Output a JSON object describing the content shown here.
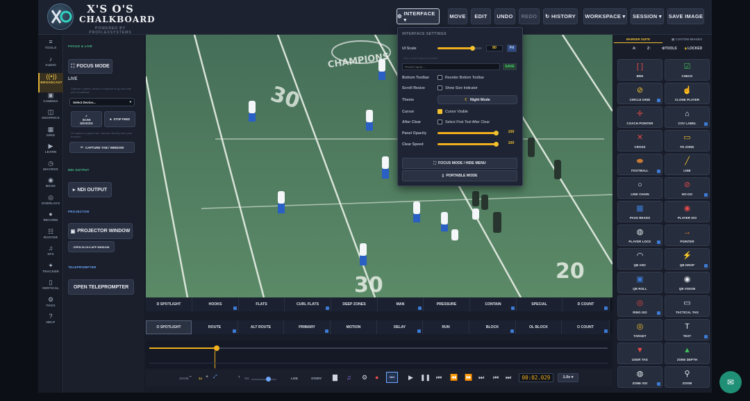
{
  "brand": {
    "line1": "X'S O'S",
    "line2": "CHALKBOARD",
    "tagline": "POWERED BY PROFLEXSYSTEMS"
  },
  "toolbar": {
    "interface": "INTERFACE ▾",
    "move": "MOVE",
    "edit": "EDIT",
    "undo": "UNDO",
    "redo": "REDO",
    "history": "HISTORY",
    "workspace": "WORKSPACE ▾",
    "session": "SESSION ▾",
    "save_image": "SAVE IMAGE"
  },
  "nav": [
    {
      "label": "TOOLS",
      "icon": "≡"
    },
    {
      "label": "AUDIO",
      "icon": "♪"
    },
    {
      "label": "BROADCAST",
      "icon": "((•))"
    },
    {
      "label": "CAMERA",
      "icon": "▣"
    },
    {
      "label": "GRAPHICS",
      "icon": "◫"
    },
    {
      "label": "GRID",
      "icon": "▦"
    },
    {
      "label": "LEARN",
      "icon": "▶"
    },
    {
      "label": "MACROS",
      "icon": "◷"
    },
    {
      "label": "MASK",
      "icon": "◉"
    },
    {
      "label": "OVERLAYS",
      "icon": "◎"
    },
    {
      "label": "RECORD",
      "icon": "●"
    },
    {
      "label": "ROSTER",
      "icon": "☷"
    },
    {
      "label": "SFX",
      "icon": "♫"
    },
    {
      "label": "TRACKER",
      "icon": "✦"
    },
    {
      "label": "VERTICAL",
      "icon": "▯"
    },
    {
      "label": "TAGS",
      "icon": "⚙"
    },
    {
      "label": "HELP",
      "icon": "?"
    }
  ],
  "left_panel": {
    "focus_live": "FOCUS & LIVE",
    "focus_mode": "FOCUS MODE",
    "live": "LIVE",
    "live_help": "Capture a game, device or window to go live with your broadcast.",
    "select_device": "Select Device...",
    "scan_devices": "SCAN DEVICES",
    "stop_feed": "STOP FEED",
    "capture_help": "Or capture a game tab / window directly from your browser.",
    "capture_tab": "CAPTURE TAB / WINDOW",
    "ndi_output_sec": "NDI OUTPUT",
    "ndi_output": "NDI OUTPUT",
    "projector_sec": "PROJECTOR",
    "projector_window": "PROJECTOR WINDOW",
    "open_app_window": "OPEN IN 16:9 APP WINDOW",
    "teleprompter_sec": "TELEPROMPTER",
    "open_teleprompter": "OPEN TELEPROMPTER"
  },
  "interface_settings": {
    "title": "INTERFACE SETTINGS",
    "ui_scale_label": "UI Scale",
    "ui_scale_value": "80",
    "ui_scale_level": 0.8,
    "fit": "Fit",
    "preset_hint": "Save current layout as preset",
    "preset_placeholder": "Preset name...",
    "save": "SAVE",
    "bottom_toolbar_label": "Bottom Toolbar",
    "bottom_toolbar_option": "Reorder Bottom Toolbar",
    "scroll_resize_label": "Scroll Resize",
    "scroll_resize_option": "Show Size Indicator",
    "theme_label": "Theme",
    "theme_value": "Night Mode",
    "cursor_label": "Cursor",
    "cursor_option": "Cursor Visible",
    "after_clear_label": "After Clear",
    "after_clear_option": "Select First Tool After Clear",
    "panel_opacity_label": "Panel Opacity",
    "panel_opacity_value": "100",
    "panel_opacity_level": 1,
    "clear_speed_label": "Clear Speed",
    "clear_speed_value": "100",
    "clear_speed_level": 1,
    "focus_mode_btn": "FOCUS MODE / HIDE MENU",
    "portable_mode_btn": "PORTABLE MODE"
  },
  "video": {
    "banner": "CHAMPIONS",
    "yard_left": "30",
    "yard_mid": "20",
    "yard_bot": "30",
    "yard_right": "20"
  },
  "playbook_row1": [
    "D SPOTLIGHT",
    "HOOKS",
    "FLATS",
    "CURL FLATS",
    "DEEP ZONES",
    "MAN",
    "PRESSURE",
    "CONTAIN",
    "SPECIAL",
    "D COUNT"
  ],
  "playbook_row2": [
    "O SPOTLIGHT",
    "ROUTE",
    "ALT ROUTE",
    "PRIMARY",
    "MOTION",
    "DELAY",
    "RUN",
    "BLOCK",
    "OL BLOCK",
    "O COUNT"
  ],
  "bottom_bar": {
    "zoom_label": "ZOOM",
    "zoom_value": "1x",
    "vol_label": "VO",
    "live": "LIVE",
    "story": "STORY",
    "timecode": "00:02.029",
    "speed": "1.0x ▾",
    "rec_badge": "NDI"
  },
  "right_panel": {
    "tab_marker": "MARKER SUITE",
    "tab_custom": "CUSTOM IMAGES",
    "sort_az": "A↑",
    "sort_za": "Z↑",
    "all_tools": "TOOLS",
    "locked": "LOCKED",
    "tools": [
      {
        "label": "BRH",
        "icon": "[ ]",
        "color": "#e34a4a"
      },
      {
        "label": "CHECK",
        "icon": "☑",
        "color": "#3fbf5a"
      },
      {
        "label": "CIRCLE GRID",
        "icon": "⊘",
        "color": "#f2c230"
      },
      {
        "label": "CLONE PLAYER",
        "icon": "☝",
        "color": "#e8ecf2"
      },
      {
        "label": "COACH POINTER",
        "icon": "✛",
        "color": "#e34a4a"
      },
      {
        "label": "COV LABEL",
        "icon": "⌂",
        "color": "#e8ecf2"
      },
      {
        "label": "CROSS",
        "icon": "✕",
        "color": "#e34a4a"
      },
      {
        "label": "FD ZONE",
        "icon": "▭",
        "color": "#f2c230"
      },
      {
        "label": "FOOTBALL",
        "icon": "⬬",
        "color": "#c77a35"
      },
      {
        "label": "LINE",
        "icon": "╱",
        "color": "#f2c230"
      },
      {
        "label": "LINK CHAIN",
        "icon": "○",
        "color": "#e8ecf2"
      },
      {
        "label": "NO-GO",
        "icon": "⊘",
        "color": "#e34a4a"
      },
      {
        "label": "PASS READS",
        "icon": "▦",
        "color": "#3d7bd6"
      },
      {
        "label": "PLAYER ISO",
        "icon": "◉",
        "color": "#e34a4a"
      },
      {
        "label": "PLAYER LOCK",
        "icon": "◍",
        "color": "#e8ecf2"
      },
      {
        "label": "POINTER",
        "icon": "→",
        "color": "#f28a2e"
      },
      {
        "label": "QB ARC",
        "icon": "◠",
        "color": "#e8ecf2"
      },
      {
        "label": "QB DROP",
        "icon": "⚡",
        "color": "#f2c230"
      },
      {
        "label": "QB ROLL",
        "icon": "▣",
        "color": "#3d7bd6"
      },
      {
        "label": "QB VISION",
        "icon": "◉",
        "color": "#e8ecf2"
      },
      {
        "label": "RING ISO",
        "icon": "◎",
        "color": "#e34a4a"
      },
      {
        "label": "TACTICAL TAG",
        "icon": "▭",
        "color": "#e8ecf2"
      },
      {
        "label": "TARGET",
        "icon": "◎",
        "color": "#f2c230"
      },
      {
        "label": "TEXT",
        "icon": "T",
        "color": "#e8ecf2"
      },
      {
        "label": "USER TAG",
        "icon": "▼",
        "color": "#e34a4a"
      },
      {
        "label": "ZONE DEPTH",
        "icon": "▲",
        "color": "#3fbf5a"
      },
      {
        "label": "ZONE ISO",
        "icon": "◍",
        "color": "#e8ecf2"
      },
      {
        "label": "ZOOM",
        "icon": "⚲",
        "color": "#e8ecf2"
      }
    ]
  },
  "colors": {
    "accent": "#f2b01e",
    "bg": "#171c28",
    "link": "#3d7bd6"
  }
}
